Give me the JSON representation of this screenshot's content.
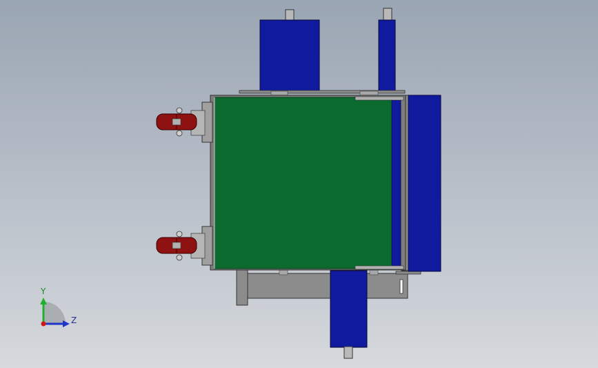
{
  "triad": {
    "y_label": "Y",
    "z_label": "Z"
  },
  "colors": {
    "background_top": "#9aa5b3",
    "background_bottom": "#d6d9dd",
    "body_green": "#0b6a2e",
    "motor_blue": "#0f1a9e",
    "frame_gray": "#8c8c8c",
    "wheel_red": "#8e1212",
    "axis_y": "#21b02c",
    "axis_z": "#2036c8",
    "axis_x": "#d01818"
  },
  "scene": {
    "view": "top",
    "components": [
      "main-body",
      "motor-top-left",
      "motor-top-right",
      "motor-right",
      "motor-bottom",
      "caster-wheel-top",
      "caster-wheel-bottom",
      "base-frame"
    ]
  }
}
